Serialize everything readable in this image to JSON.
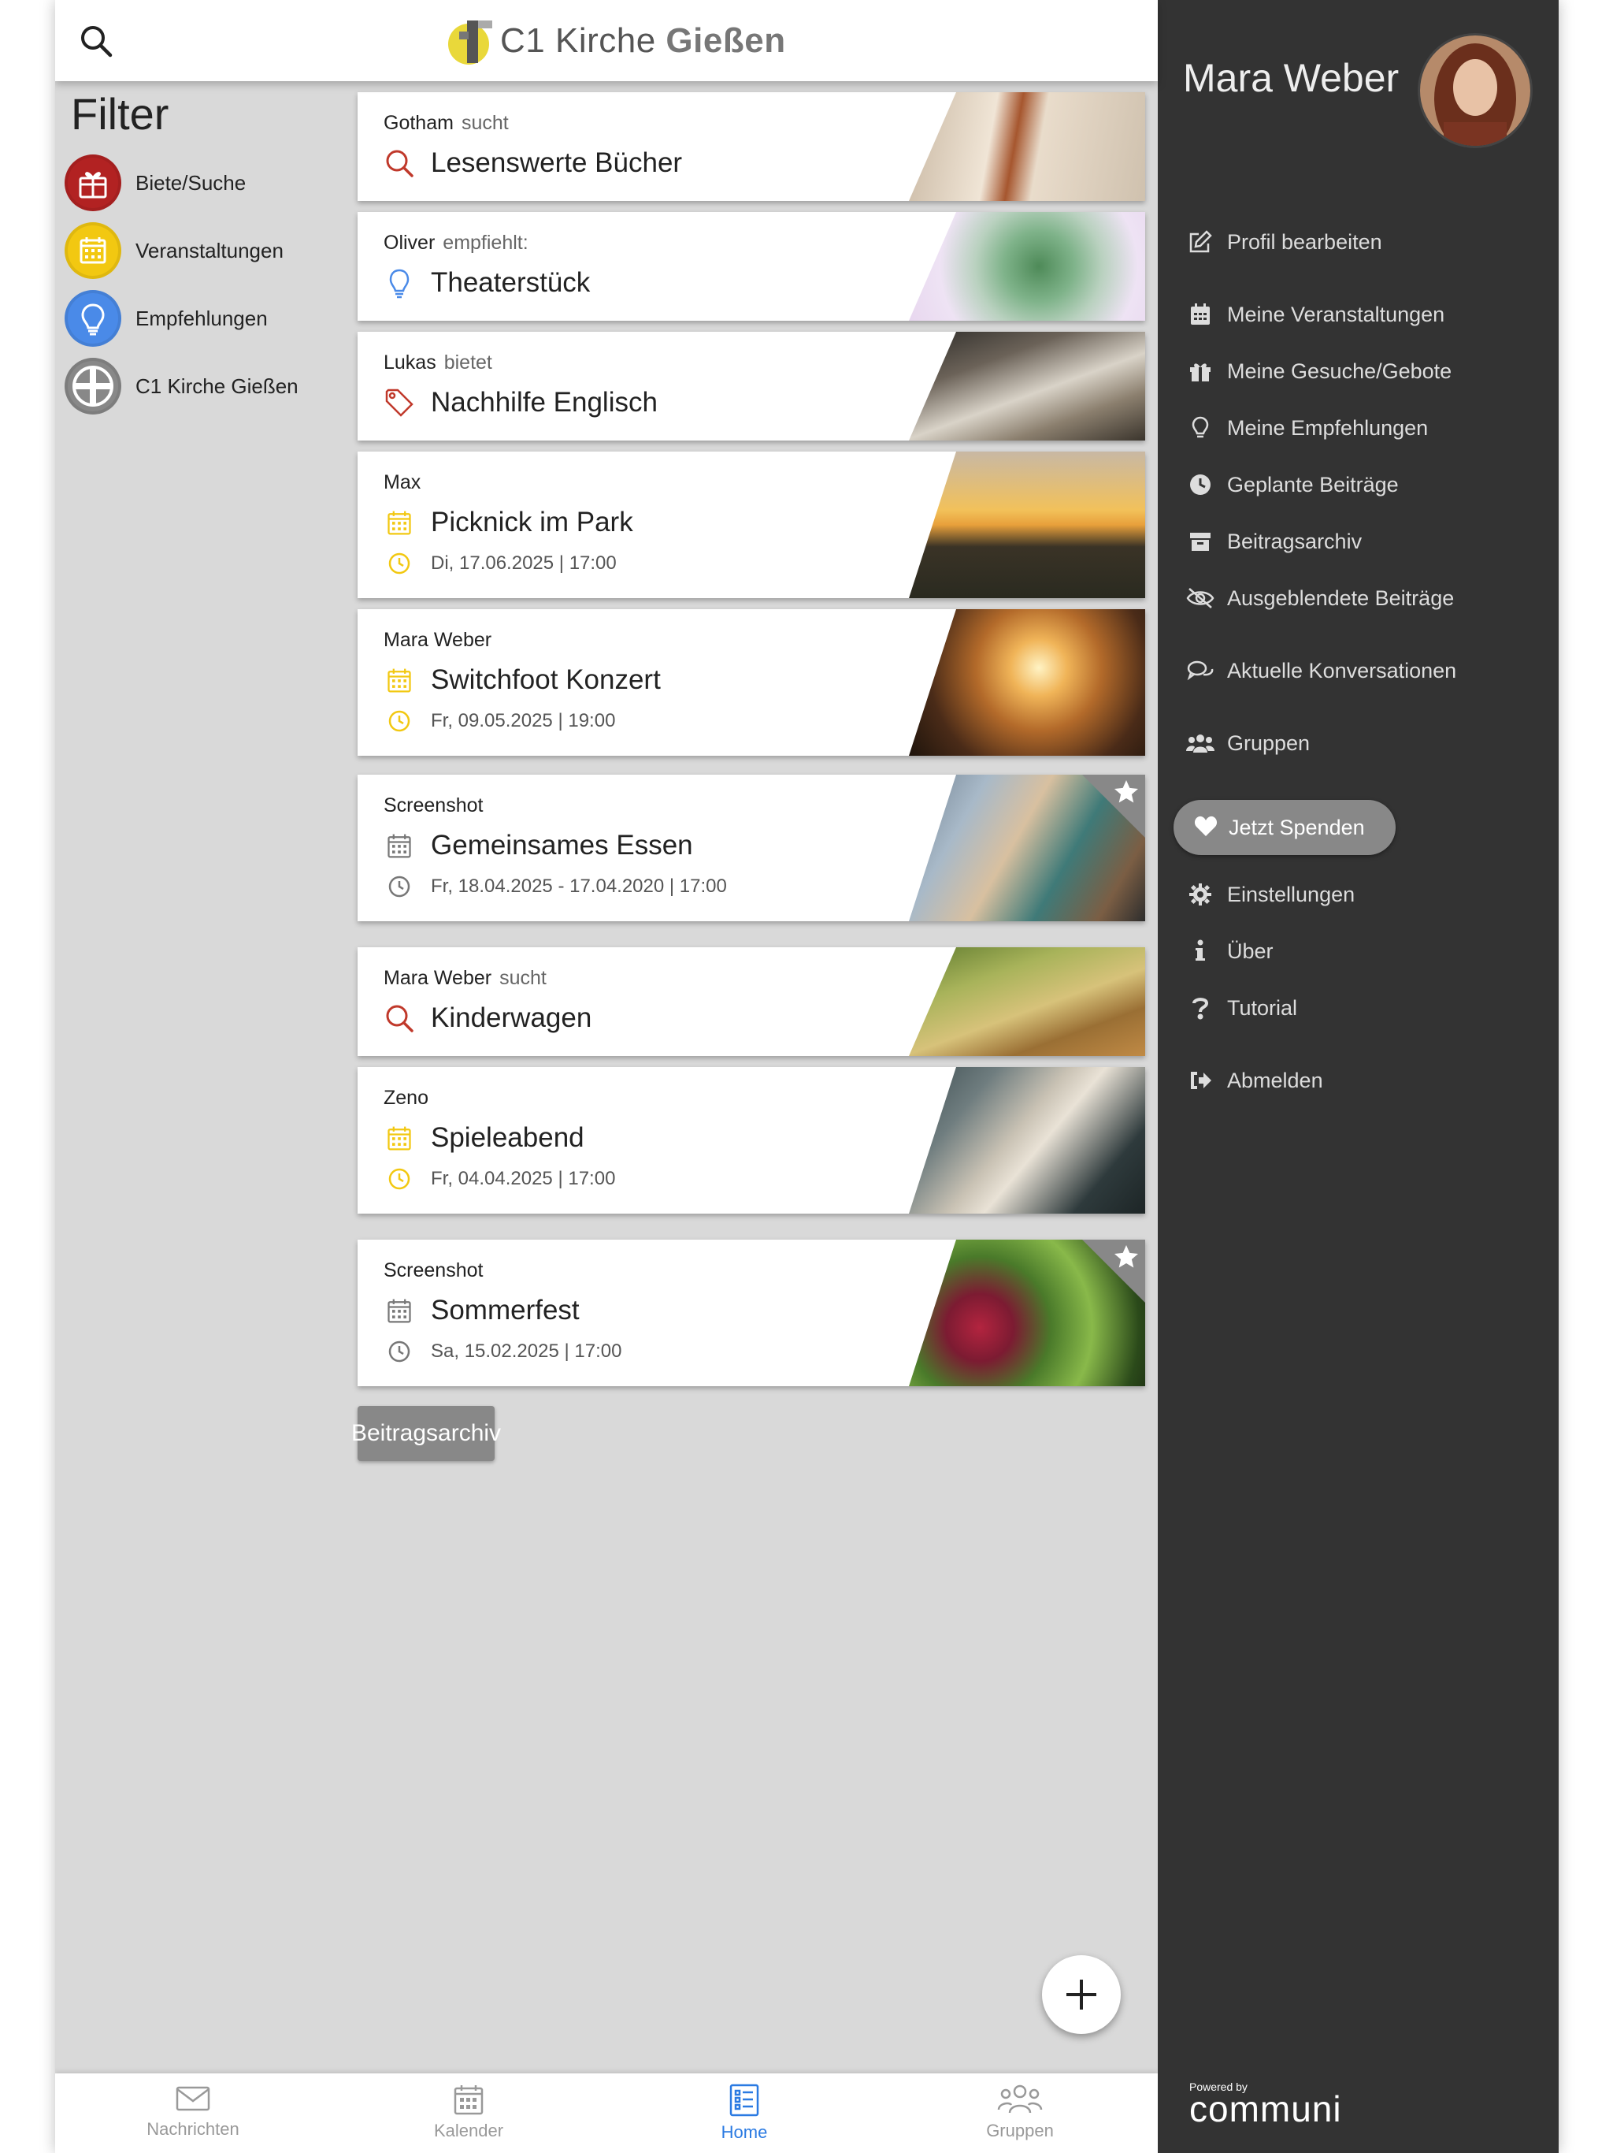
{
  "header": {
    "logo_text_1": "C1 Kirche ",
    "logo_text_2": "Gießen"
  },
  "filter": {
    "title": "Filter",
    "items": [
      {
        "label": "Biete/Suche",
        "color": "#b22222",
        "icon": "gift-icon"
      },
      {
        "label": "Veranstaltungen",
        "color": "#f2c811",
        "icon": "calendar-icon"
      },
      {
        "label": "Empfehlungen",
        "color": "#4a8ae8",
        "icon": "lightbulb-icon"
      },
      {
        "label": "C1 Kirche Gießen",
        "color": "#888888",
        "icon": "group-cross-icon"
      }
    ]
  },
  "feed": {
    "cards": [
      {
        "author": "Gotham",
        "verb": "sucht",
        "title": "Lesenswerte Bücher",
        "icon": "search-icon",
        "date": "",
        "starred": false
      },
      {
        "author": "Oliver",
        "verb": "empfiehlt:",
        "title": "Theaterstück",
        "icon": "lightbulb-icon",
        "date": "",
        "starred": false
      },
      {
        "author": "Lukas",
        "verb": "bietet",
        "title": "Nachhilfe Englisch",
        "icon": "tag-icon",
        "date": "",
        "starred": false
      },
      {
        "author": "Max",
        "verb": "",
        "title": "Picknick im Park",
        "icon": "calendar-icon",
        "date": "Di, 17.06.2025 | 17:00",
        "starred": false
      },
      {
        "author": "Mara Weber",
        "verb": "",
        "title": "Switchfoot Konzert",
        "icon": "calendar-icon",
        "date": "Fr, 09.05.2025 | 19:00",
        "starred": false
      },
      {
        "author": "Screenshot",
        "verb": "",
        "title": "Gemeinsames Essen",
        "icon": "calendar-icon",
        "date": "Fr, 18.04.2025 - 17.04.2020 | 17:00",
        "starred": true
      },
      {
        "author": "Mara Weber",
        "verb": "sucht",
        "title": "Kinderwagen",
        "icon": "search-icon",
        "date": "",
        "starred": false
      },
      {
        "author": "Zeno",
        "verb": "",
        "title": "Spieleabend",
        "icon": "calendar-icon",
        "date": "Fr, 04.04.2025 | 17:00",
        "starred": false
      },
      {
        "author": "Screenshot",
        "verb": "",
        "title": "Sommerfest",
        "icon": "calendar-icon",
        "date": "Sa, 15.02.2025 | 17:00",
        "starred": true
      }
    ],
    "archive_button": "Beitragsarchiv"
  },
  "bottom_nav": [
    {
      "label": "Nachrichten",
      "icon": "envelope-icon",
      "active": false
    },
    {
      "label": "Kalender",
      "icon": "calendar-icon",
      "active": false
    },
    {
      "label": "Home",
      "icon": "list-icon",
      "active": true
    },
    {
      "label": "Gruppen",
      "icon": "people-icon",
      "active": false
    }
  ],
  "drawer": {
    "user_name": "Mara Weber",
    "menu": [
      {
        "label": "Profil bearbeiten",
        "icon": "edit-icon"
      },
      {
        "label": "Meine Veranstaltungen",
        "icon": "calendar-icon"
      },
      {
        "label": "Meine Gesuche/Gebote",
        "icon": "gift-icon"
      },
      {
        "label": "Meine Empfehlungen",
        "icon": "lightbulb-icon"
      },
      {
        "label": "Geplante Beiträge",
        "icon": "clock-icon"
      },
      {
        "label": "Beitragsarchiv",
        "icon": "archive-icon"
      },
      {
        "label": "Ausgeblendete Beiträge",
        "icon": "eye-slash-icon"
      },
      {
        "label": "Aktuelle Konversationen",
        "icon": "chat-icon"
      },
      {
        "label": "Gruppen",
        "icon": "users-icon"
      },
      {
        "label": "Einstellungen",
        "icon": "gear-icon"
      },
      {
        "label": "Über",
        "icon": "info-icon"
      },
      {
        "label": "Tutorial",
        "icon": "question-icon"
      },
      {
        "label": "Abmelden",
        "icon": "logout-icon"
      }
    ],
    "donate_label": "Jetzt Spenden",
    "powered_by": "Powered by",
    "brand": "communi"
  },
  "colors": {
    "drawer_bg": "#333333",
    "feed_bg": "#d9d9d9",
    "search_red": "#c0392b",
    "event_yellow": "#f2c811",
    "recommend_blue": "#4a8ae8",
    "nav_active": "#2a7ae2"
  }
}
